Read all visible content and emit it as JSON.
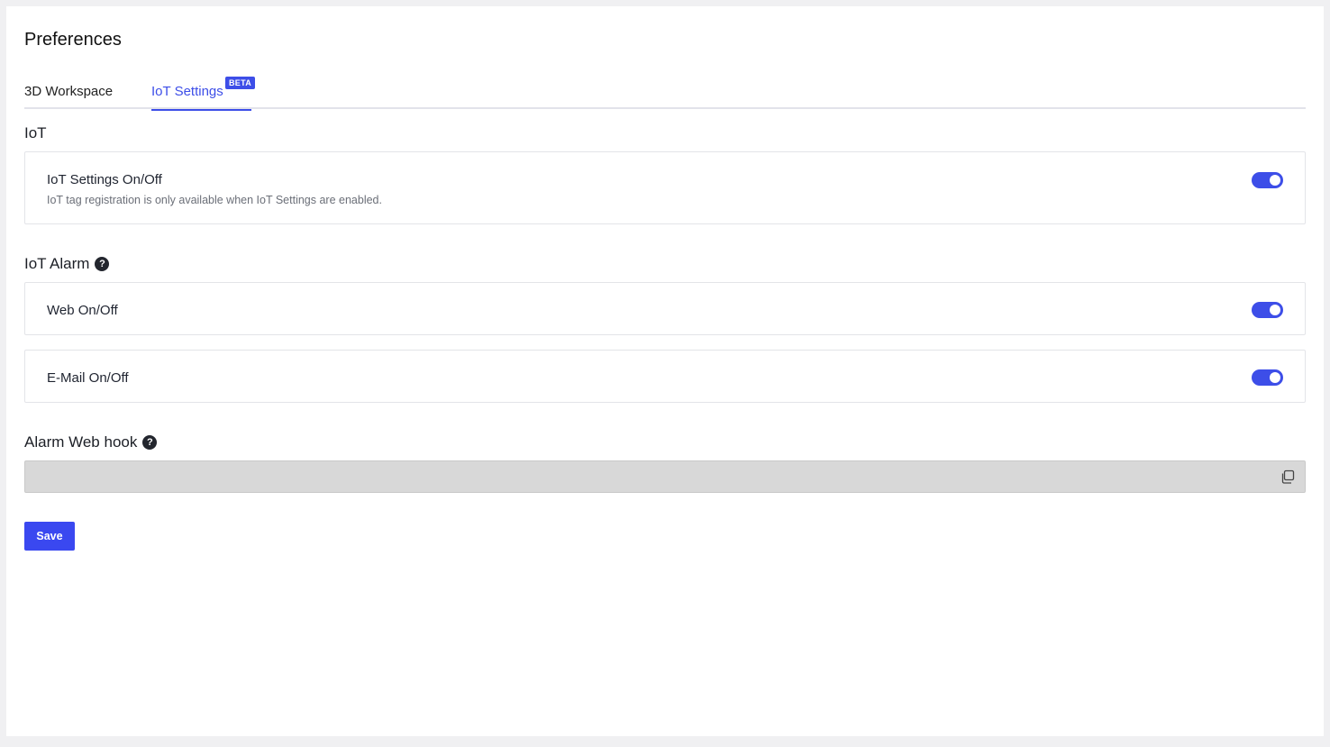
{
  "page": {
    "title": "Preferences"
  },
  "tabs": [
    {
      "label": "3D Workspace",
      "active": false
    },
    {
      "label": "IoT Settings",
      "active": true,
      "badge": "BETA"
    }
  ],
  "iot_section": {
    "title": "IoT",
    "settings_toggle": {
      "label": "IoT Settings On/Off",
      "description": "IoT tag registration is only available when IoT Settings are enabled.",
      "enabled": true
    }
  },
  "alarm_section": {
    "title": "IoT Alarm",
    "help_icon": "question-circle-icon",
    "web_toggle": {
      "label": "Web On/Off",
      "enabled": true
    },
    "email_toggle": {
      "label": "E-Mail On/Off",
      "enabled": true
    }
  },
  "webhook_section": {
    "title": "Alarm Web hook",
    "help_icon": "question-circle-icon",
    "value": "",
    "copy_icon": "copy-icon"
  },
  "actions": {
    "save_label": "Save"
  },
  "colors": {
    "accent": "#3d4ee8",
    "disabled_field": "#d8d8d8"
  }
}
